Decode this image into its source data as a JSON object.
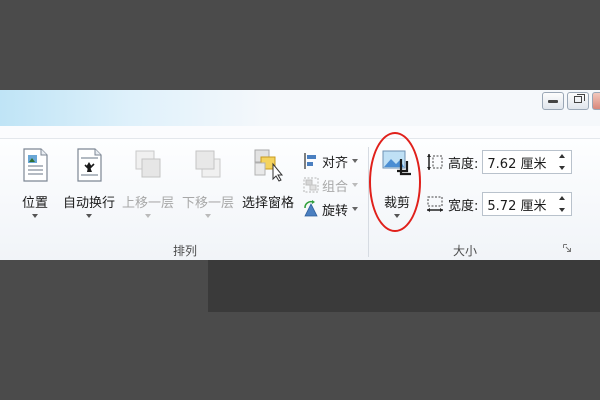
{
  "ribbon": {
    "groups": {
      "arrange": {
        "label": "排列",
        "buttons": {
          "position": "位置",
          "wrap_text": "自动换行",
          "bring_forward": "上移一层",
          "send_backward": "下移一层",
          "selection_pane": "选择窗格",
          "align": "对齐",
          "group": "组合",
          "rotate": "旋转"
        }
      },
      "size": {
        "label": "大小",
        "crop": "裁剪",
        "height_label": "高度:",
        "height_value": "7.62 厘米",
        "width_label": "宽度:",
        "width_value": "5.72 厘米"
      }
    }
  },
  "colors": {
    "highlight": "#e0201b",
    "titlebar_accent": "#bfe4f6",
    "disabled_text": "#a8a8a8"
  },
  "icons": {
    "window_minimize": "minimize-icon",
    "window_restore": "restore-icon",
    "window_close": "close-icon",
    "dialog_launcher": "dialog-launcher-icon"
  }
}
